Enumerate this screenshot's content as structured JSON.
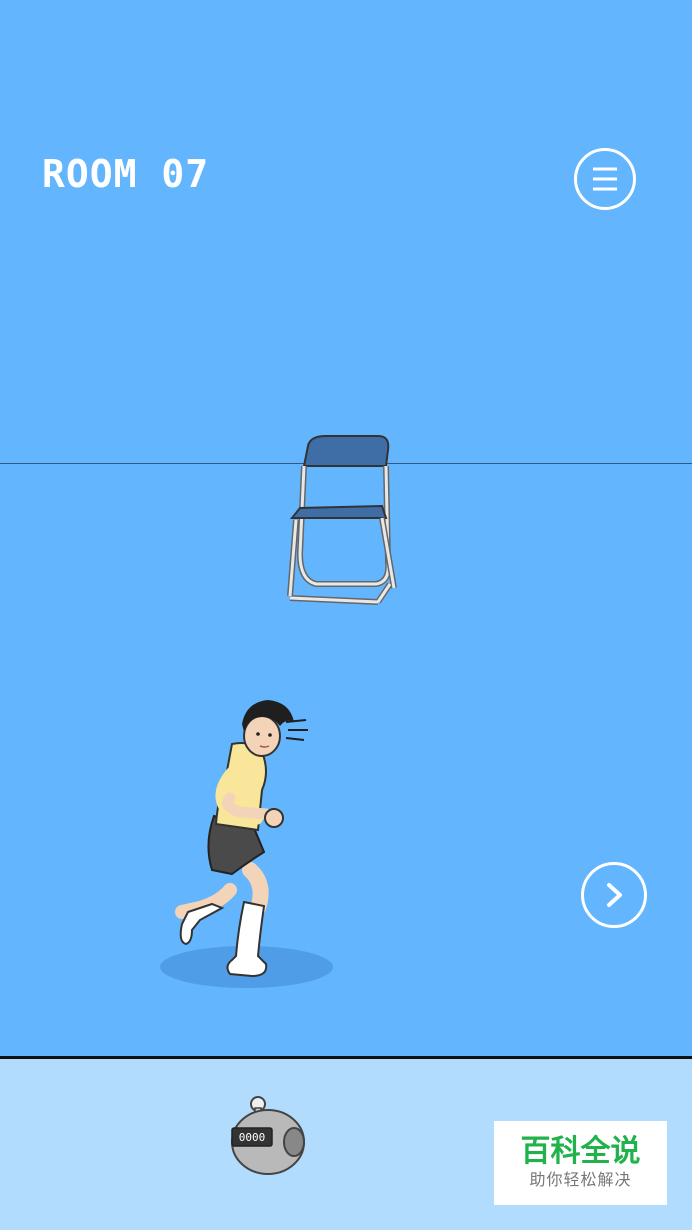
{
  "header": {
    "room_label": "ROOM 07"
  },
  "icons": {
    "menu": "menu-icon",
    "next": "chevron-right-icon"
  },
  "scene": {
    "objects": [
      "folding-chair",
      "running-girl"
    ]
  },
  "inventory": {
    "counter_display": "0000"
  },
  "watermark": {
    "title": "百科全说",
    "subtitle": "助你轻松解决"
  },
  "colors": {
    "sky": "#63b6fd",
    "inventory_bg": "#b1dcfd",
    "chair_seat": "#3f6ea6",
    "shirt": "#fae69a",
    "skirt": "#4a4a4a",
    "watermark_green": "#22b24c"
  }
}
